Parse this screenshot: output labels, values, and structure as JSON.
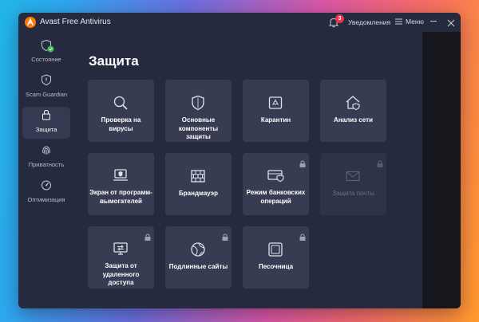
{
  "window": {
    "title": "Avast Free Antivirus"
  },
  "titlebar": {
    "notifications_label": "Уведомления",
    "notifications_count": "3",
    "menu_label": "Меню"
  },
  "colors": {
    "accent": "#ff7800",
    "badge": "#e8344c",
    "status_ok": "#3fbf4f",
    "panel": "#262a3e",
    "tile": "#373c53"
  },
  "sidebar": {
    "items": [
      {
        "label": "Состояние",
        "icon": "shield-check-icon",
        "active": false
      },
      {
        "label": "Scam Guardian",
        "icon": "scam-guardian-icon",
        "active": false
      },
      {
        "label": "Защита",
        "icon": "lock-icon",
        "active": true
      },
      {
        "label": "Приватность",
        "icon": "fingerprint-icon",
        "active": false
      },
      {
        "label": "Оптимизация",
        "icon": "speedometer-icon",
        "active": false
      }
    ]
  },
  "main": {
    "title": "Защита",
    "tiles": [
      {
        "label": "Проверка на вирусы",
        "icon": "magnifier-icon",
        "locked": false,
        "disabled": false
      },
      {
        "label": "Основные компоненты защиты",
        "icon": "shield-icon",
        "locked": false,
        "disabled": false
      },
      {
        "label": "Карантин",
        "icon": "quarantine-icon",
        "locked": false,
        "disabled": false
      },
      {
        "label": "Анализ сети",
        "icon": "home-network-icon",
        "locked": false,
        "disabled": false
      },
      {
        "label": "Экран от программ-вымогателей",
        "icon": "ransomware-shield-icon",
        "locked": false,
        "disabled": false
      },
      {
        "label": "Брандмауэр",
        "icon": "firewall-icon",
        "locked": false,
        "disabled": false
      },
      {
        "label": "Режим банковских операций",
        "icon": "banking-icon",
        "locked": true,
        "disabled": false
      },
      {
        "label": "Защита почты",
        "icon": "mail-icon",
        "locked": true,
        "disabled": true
      },
      {
        "label": "Защита от удаленного доступа",
        "icon": "remote-access-icon",
        "locked": true,
        "disabled": false
      },
      {
        "label": "Подлинные сайты",
        "icon": "globe-icon",
        "locked": true,
        "disabled": false
      },
      {
        "label": "Песочница",
        "icon": "sandbox-icon",
        "locked": true,
        "disabled": false
      }
    ]
  }
}
